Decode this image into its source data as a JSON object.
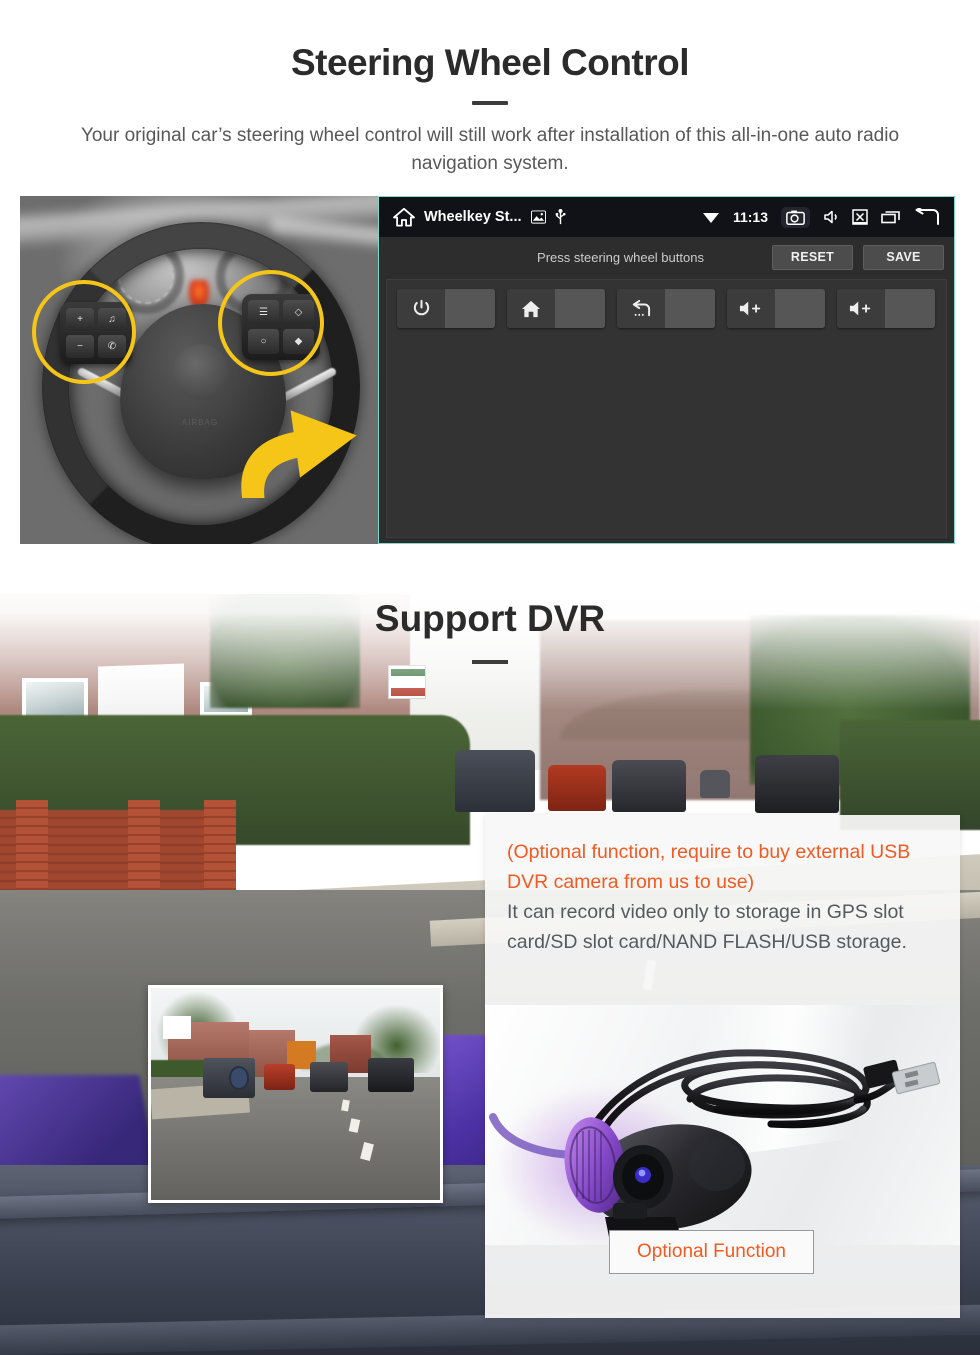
{
  "section1": {
    "title": "Steering Wheel Control",
    "subtitle": "Your original car’s steering wheel control will still work after installation of this all-in-one auto radio navigation system.",
    "unit": {
      "status_bar": {
        "home_icon": "home-icon",
        "app_title": "Wheelkey St...",
        "gallery_icon": "image-icon",
        "usb_icon": "usb-icon",
        "wifi_icon": "wifi-icon",
        "time": "11:13",
        "camera_icon": "screenshot-camera-icon",
        "volume_icon": "volume-mute-icon",
        "close_icon": "close-box-icon",
        "recents_icon": "recent-apps-icon",
        "back_icon": "back-arrow-icon"
      },
      "toolbar": {
        "hint": "Press steering wheel buttons",
        "reset_label": "RESET",
        "save_label": "SAVE"
      },
      "keys": [
        {
          "icon": "power-icon",
          "label": ""
        },
        {
          "icon": "home-icon",
          "label": ""
        },
        {
          "icon": "back-icon",
          "label": ""
        },
        {
          "icon": "volume-up-icon",
          "label": ""
        },
        {
          "icon": "volume-up-icon",
          "label": ""
        }
      ]
    },
    "wheel_photo": {
      "left_pad_keys": [
        "+",
        "−",
        "♫",
        "✆"
      ],
      "right_pad_keys": [
        "☰",
        "◇",
        "○",
        "◆"
      ],
      "hub_text": "AIRBAG",
      "highlight_color": "#f5c518",
      "arrow_color": "#f5c518"
    }
  },
  "section2": {
    "title": "Support DVR",
    "panel": {
      "note_orange": "(Optional function, require to buy external USB DVR camera from us to use)",
      "note_grey": "It can record video only to storage in GPS slot card/SD slot card/NAND FLASH/USB storage.",
      "button_label": "Optional Function",
      "orange_color": "#f15a22"
    },
    "inset_label": "dashcam-preview"
  }
}
